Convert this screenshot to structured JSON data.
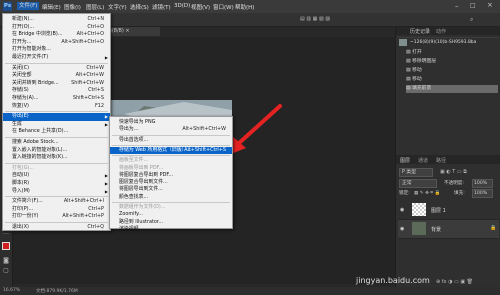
{
  "menubar": {
    "items": [
      "文件(F)",
      "编辑(E)",
      "图像(I)",
      "图层(L)",
      "文字(Y)",
      "选择(S)",
      "滤镜(T)",
      "3D(D)",
      "视图(V)",
      "窗口(W)",
      "帮助(H)"
    ]
  },
  "document": {
    "tab_label": "%(8)(8/8) ×",
    "zoom": "16.67%",
    "status": "文档:879.9K/1.76M"
  },
  "file_menu": {
    "items": [
      {
        "label": "新建(N)...",
        "shortcut": "Ctrl+N"
      },
      {
        "label": "打开(O)...",
        "shortcut": "Ctrl+O"
      },
      {
        "label": "在 Bridge 中浏览(B)...",
        "shortcut": "Alt+Ctrl+O"
      },
      {
        "label": "打开为...",
        "shortcut": "Alt+Shift+Ctrl+O"
      },
      {
        "label": "打开为智能对象...",
        "shortcut": ""
      },
      {
        "label": "最近打开文件(T)",
        "shortcut": "",
        "submenu": true
      },
      {
        "label": "关闭(C)",
        "shortcut": "Ctrl+W"
      },
      {
        "label": "关闭全部",
        "shortcut": "Alt+Ctrl+W"
      },
      {
        "label": "关闭并转到 Bridge...",
        "shortcut": "Shift+Ctrl+W"
      },
      {
        "label": "存储(S)",
        "shortcut": "Ctrl+S"
      },
      {
        "label": "存储为(A)...",
        "shortcut": "Shift+Ctrl+S"
      },
      {
        "label": "恢复(V)",
        "shortcut": "F12"
      },
      {
        "label": "导出(E)",
        "shortcut": "",
        "submenu": true,
        "highlight": true
      },
      {
        "label": "生成",
        "shortcut": "",
        "submenu": true
      },
      {
        "label": "在 Behance 上共享(D)...",
        "shortcut": ""
      },
      {
        "label": "搜索 Adobe Stock...",
        "shortcut": ""
      },
      {
        "label": "置入嵌入的智能对象(L)...",
        "shortcut": ""
      },
      {
        "label": "置入链接的智能对象(K)...",
        "shortcut": ""
      },
      {
        "label": "打包(G)...",
        "shortcut": "",
        "disabled": true
      },
      {
        "label": "自动(U)",
        "shortcut": "",
        "submenu": true
      },
      {
        "label": "脚本(R)",
        "shortcut": "",
        "submenu": true
      },
      {
        "label": "导入(M)",
        "shortcut": "",
        "submenu": true
      },
      {
        "label": "文件简介(F)...",
        "shortcut": "Alt+Shift+Ctrl+I"
      },
      {
        "label": "打印(P)...",
        "shortcut": "Ctrl+P"
      },
      {
        "label": "打印一份(Y)",
        "shortcut": "Alt+Shift+Ctrl+P"
      },
      {
        "label": "退出(X)",
        "shortcut": "Ctrl+Q"
      }
    ]
  },
  "export_submenu": {
    "items": [
      {
        "label": "快速导出为 PNG",
        "shortcut": ""
      },
      {
        "label": "导出为...",
        "shortcut": "Alt+Shift+Ctrl+W"
      },
      {
        "label": "导出首选项...",
        "shortcut": ""
      },
      {
        "label": "存储为 Web 所用格式（旧版）...",
        "shortcut": "Alt+Shift+Ctrl+S",
        "highlight": true
      },
      {
        "label": "画板至文件...",
        "shortcut": "",
        "disabled": true
      },
      {
        "label": "将画板导出到 PDF...",
        "shortcut": "",
        "disabled": true
      },
      {
        "label": "将图层复合导出到 PDF...",
        "shortcut": ""
      },
      {
        "label": "图层复合导出到文件...",
        "shortcut": ""
      },
      {
        "label": "将图层导出到文件...",
        "shortcut": ""
      },
      {
        "label": "颜色查找表...",
        "shortcut": ""
      },
      {
        "label": "数据组作为文件(D)...",
        "shortcut": "",
        "disabled": true
      },
      {
        "label": "Zoomify...",
        "shortcut": ""
      },
      {
        "label": "路径到 Illustrator...",
        "shortcut": ""
      },
      {
        "label": "渲染视频...",
        "shortcut": ""
      }
    ]
  },
  "history_panel": {
    "tabs": [
      "历史记录",
      "动作"
    ],
    "snapshot": "~126(8)(9)(10)b-SH9593.8ba",
    "items": [
      "打开",
      "移除明图层",
      "移动",
      "移动",
      "填充前景"
    ]
  },
  "layers_panel": {
    "tabs": [
      "图层",
      "通道",
      "路径"
    ],
    "kind_filter": "P 类型",
    "blend_mode": "正常",
    "opacity_label": "不透明度:",
    "opacity_value": "100%",
    "lock_label": "锁定:",
    "fill_label": "填充:",
    "fill_value": "100%",
    "layers": [
      "图层 1",
      "背景"
    ]
  },
  "watermark": "jingyan.baidu.com",
  "colors": {
    "accent": "#0a64c8",
    "arrow": "#e52222",
    "foreground": "#d11f1f"
  }
}
